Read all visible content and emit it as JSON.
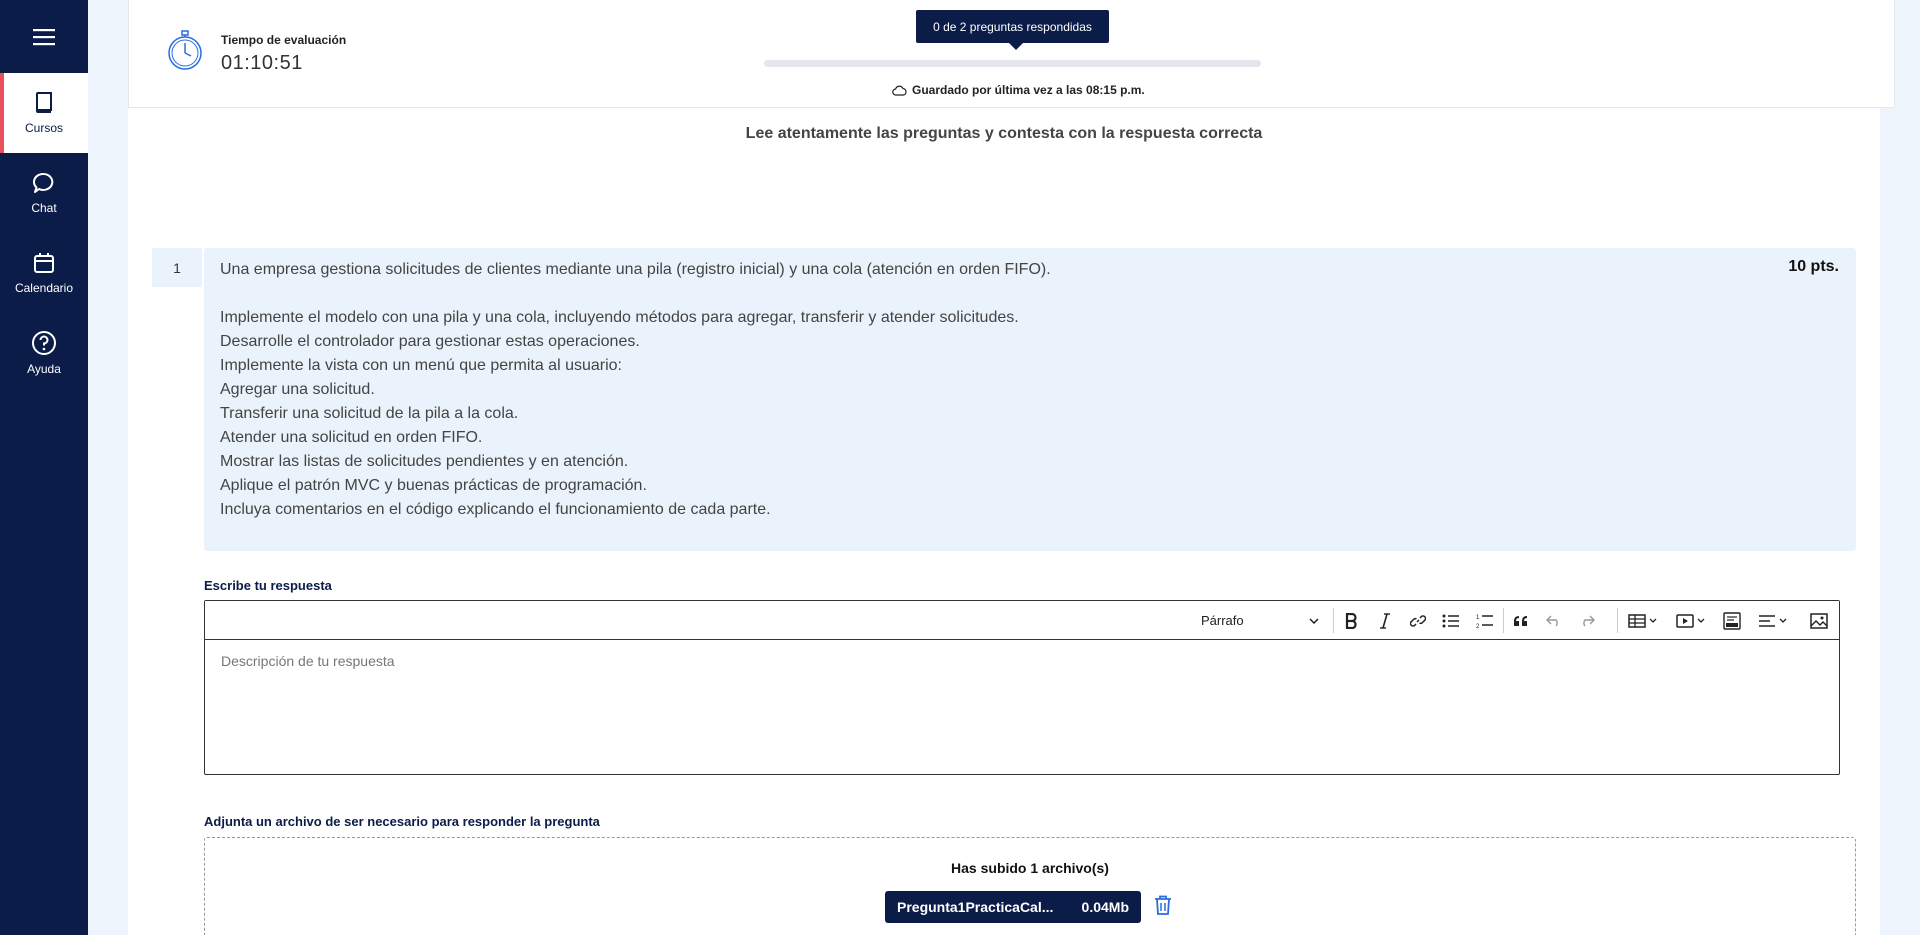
{
  "sidebar": {
    "menu_icon": "hamburger-icon",
    "items": [
      {
        "label": "Cursos",
        "icon": "book-icon",
        "active": true
      },
      {
        "label": "Chat",
        "icon": "chat-bubble-icon",
        "active": false
      },
      {
        "label": "Calendario",
        "icon": "calendar-icon",
        "active": false
      },
      {
        "label": "Ayuda",
        "icon": "help-circle-icon",
        "active": false
      }
    ]
  },
  "header": {
    "timer_label": "Tiempo de evaluación",
    "timer_value": "01:10:51",
    "progress_tooltip": "0 de 2 preguntas respondidas",
    "progress_fraction": 0,
    "saved_text": "Guardado por última vez a las 08:15 p.m."
  },
  "instructions": "Lee atentamente las preguntas y contesta con la respuesta correcta",
  "question": {
    "number": "1",
    "points": "10 pts.",
    "intro": "Una empresa gestiona solicitudes de clientes mediante una pila (registro inicial) y una cola (atención en orden FIFO).",
    "lines": [
      "Implemente el modelo con una pila y una cola, incluyendo métodos para agregar, transferir y atender solicitudes.",
      "Desarrolle el controlador para gestionar estas operaciones.",
      "Implemente la vista con un menú que permita al usuario:",
      "Agregar una solicitud.",
      "Transferir una solicitud de la pila a la cola.",
      "Atender una solicitud en orden FIFO.",
      "Mostrar las listas de solicitudes pendientes y en atención.",
      "Aplique el patrón MVC y buenas prácticas de programación.",
      "Incluya comentarios en el código explicando el funcionamiento de cada parte."
    ]
  },
  "answer": {
    "label": "Escribe tu respuesta",
    "format_select": "Párrafo",
    "placeholder": "Descripción de tu respuesta"
  },
  "attachment": {
    "label": "Adjunta un archivo de ser necesario para responder la pregunta",
    "uploaded_title": "Has subido 1 archivo(s)",
    "file_name": "Pregunta1PracticaCal...",
    "file_size": "0.04Mb"
  },
  "colors": {
    "sidebar_bg": "#0b1c48",
    "accent": "#e8505b",
    "question_bg": "#eaf3fc",
    "trash": "#2a6de0"
  }
}
